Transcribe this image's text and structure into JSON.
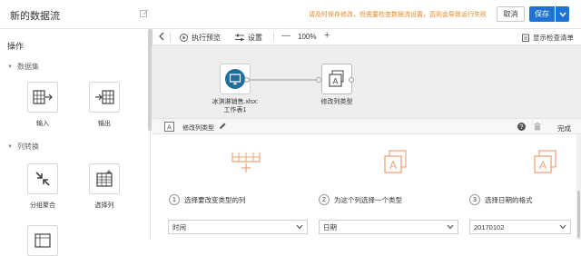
{
  "header": {
    "title": "新的数据流",
    "warning": "请及时保存修改，但需要检查数据流设置，否则会导致运行失败",
    "cancel_label": "取消",
    "save_label": "保存"
  },
  "sidebar": {
    "title": "操作",
    "sections": [
      {
        "label": "数据集",
        "tools": [
          {
            "label": "输入",
            "icon": "input-icon"
          },
          {
            "label": "输出",
            "icon": "output-icon"
          }
        ]
      },
      {
        "label": "列转换",
        "tools": [
          {
            "label": "分组聚合",
            "icon": "group-aggregate-icon"
          },
          {
            "label": "选择列",
            "icon": "select-columns-icon"
          }
        ]
      }
    ]
  },
  "toolbar": {
    "run_preview": "执行预览",
    "settings": "设置",
    "zoom": "100%",
    "checklist": "显示检查清单"
  },
  "canvas": {
    "nodes": [
      {
        "label_line1": "冰淇淋销售.xlsx:",
        "label_line2": "工作表1",
        "icon": "monitor-icon"
      },
      {
        "label_line1": "修改列类型",
        "label_line2": "",
        "icon": "change-type-icon"
      }
    ]
  },
  "panel": {
    "title": "修改列类型",
    "done_label": "完成"
  },
  "steps": [
    {
      "number": "1",
      "label": "选择要改变类型的列",
      "value": "时间"
    },
    {
      "number": "2",
      "label": "为这个列选择一个类型",
      "value": "日期"
    },
    {
      "number": "3",
      "label": "选择日期的格式",
      "value": "20170102"
    }
  ],
  "colors": {
    "accent": "#1f73d6",
    "warning": "#e58a2b",
    "step_icon": "#f0a37a",
    "node_icon": "#1f6f9c"
  }
}
